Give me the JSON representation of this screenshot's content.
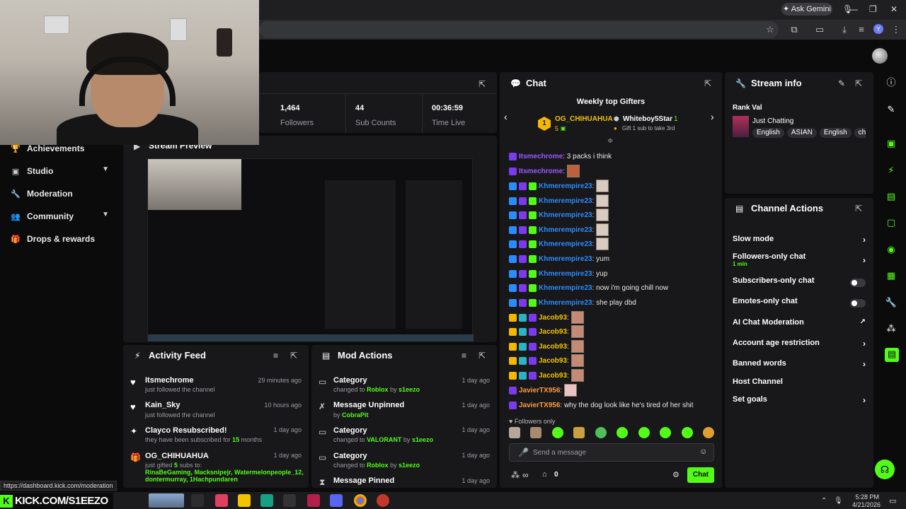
{
  "browser": {
    "gemini_label": "Ask Gemini"
  },
  "sidebar": {
    "items": [
      {
        "label": "Achievements",
        "icon": "trophy-icon"
      },
      {
        "label": "Studio",
        "icon": "studio-icon"
      },
      {
        "label": "Moderation",
        "icon": "wrench-icon"
      },
      {
        "label": "Community",
        "icon": "people-icon"
      },
      {
        "label": "Drops & rewards",
        "icon": "gift-icon"
      }
    ]
  },
  "stats": {
    "followers_value": "1,464",
    "followers_label": "Followers",
    "subs_value": "44",
    "subs_label": "Sub Counts",
    "time_value": "00:36:59",
    "time_label": "Time Live"
  },
  "stream_preview": {
    "title": "Stream Preview"
  },
  "activity": {
    "title": "Activity Feed",
    "items": [
      {
        "name": "Itsmechrome",
        "sub": "just followed the channel",
        "time": "29 minutes ago"
      },
      {
        "name": "Kain_Sky",
        "sub": "just followed the channel",
        "time": "10 hours ago"
      },
      {
        "name": "Clayco Resubscribed!",
        "sub": "they have been subscribed for",
        "months": "15",
        "months_label": "months",
        "time": "1 day ago"
      },
      {
        "name": "OG_CHIHUAHUA",
        "sub": "just gifted",
        "gift_count": "5",
        "gift_label": "subs to:",
        "recipients_1": "RinaBeGaming, Macksnipejr, Watermelonpeople_12,",
        "recipients_2": "dontermurray, 1Hachpundaren",
        "time": "1 day ago"
      }
    ]
  },
  "mod_actions": {
    "title": "Mod Actions",
    "items": [
      {
        "title": "Category",
        "sub_pre": "changed to",
        "sub_val": "Roblox",
        "by": "by",
        "user": "s1eezo",
        "time": "1 day ago"
      },
      {
        "title": "Message Unpinned",
        "sub_pre": "by",
        "sub_val": "",
        "by": "",
        "user": "CobraPit",
        "time": "1 day ago"
      },
      {
        "title": "Category",
        "sub_pre": "changed to",
        "sub_val": "VALORANT",
        "by": "by",
        "user": "s1eezo",
        "time": "1 day ago"
      },
      {
        "title": "Category",
        "sub_pre": "changed to",
        "sub_val": "Roblox",
        "by": "by",
        "user": "s1eezo",
        "time": "1 day ago"
      },
      {
        "title": "Message Pinned",
        "sub_pre": "",
        "sub_val": "",
        "by": "",
        "user": "",
        "time": "1 day ago"
      }
    ]
  },
  "chat": {
    "title": "Chat",
    "gifters_title": "Weekly top Gifters",
    "gifter1_name": "OG_CHIHUAHUA",
    "gifter1_count": "5",
    "gifter1_rank": "1",
    "gifter2_name": "Whiteboy5Star",
    "gifter2_count": "1",
    "gifter2_note": "Gift 1 sub to take 3rd",
    "messages": [
      {
        "user": "Itsmechrome",
        "text": ": 3 packs i think",
        "color": "#9b59ff"
      },
      {
        "user": "Itsmechrome",
        "text": ":",
        "color": "#9b59ff"
      },
      {
        "user": "Khmerempire23",
        "text": ":",
        "color": "#2b8cff"
      },
      {
        "user": "Khmerempire23",
        "text": ":",
        "color": "#2b8cff"
      },
      {
        "user": "Khmerempire23",
        "text": ":",
        "color": "#2b8cff"
      },
      {
        "user": "Khmerempire23",
        "text": ":",
        "color": "#2b8cff"
      },
      {
        "user": "Khmerempire23",
        "text": ":",
        "color": "#2b8cff"
      },
      {
        "user": "Khmerempire23",
        "text": ": yum",
        "color": "#2b8cff"
      },
      {
        "user": "Khmerempire23",
        "text": ": yup",
        "color": "#2b8cff"
      },
      {
        "user": "Khmerempire23",
        "text": ": now i'm going chill now",
        "color": "#2b8cff"
      },
      {
        "user": "Khmerempire23",
        "text": ": she play dbd",
        "color": "#2b8cff"
      },
      {
        "user": "Jacob93",
        "text": ":",
        "color": "#f5c400"
      },
      {
        "user": "Jacob93",
        "text": ":",
        "color": "#f5c400"
      },
      {
        "user": "Jacob93",
        "text": ":",
        "color": "#f5c400"
      },
      {
        "user": "Jacob93",
        "text": ":",
        "color": "#f5c400"
      },
      {
        "user": "Jacob93",
        "text": ":",
        "color": "#f5c400"
      },
      {
        "user": "JavierTX956",
        "text": ":",
        "color": "#ff9a3c"
      },
      {
        "user": "JavierTX956",
        "text": ": why the dog look like he's tired of her shit",
        "color": "#ff9a3c"
      }
    ],
    "followers_only": "Followers only",
    "input_placeholder": "Send a message",
    "viewer_count": "0",
    "send_label": "Chat"
  },
  "stream_info": {
    "title": "Stream info",
    "stream_title": "Rank Val",
    "category": "Just Chatting",
    "tags": [
      "English",
      "ASIAN",
      "English",
      "chil"
    ]
  },
  "channel_actions": {
    "title": "Channel Actions",
    "rows": [
      {
        "label": "Slow mode",
        "sub": "",
        "kind": "chevron"
      },
      {
        "label": "Followers-only chat",
        "sub": "1 min",
        "kind": "chevron"
      },
      {
        "label": "Subscribers-only chat",
        "sub": "",
        "kind": "toggle"
      },
      {
        "label": "Emotes-only chat",
        "sub": "",
        "kind": "toggle"
      },
      {
        "label": "AI Chat Moderation",
        "sub": "",
        "kind": "external"
      },
      {
        "label": "Account age restriction",
        "sub": "",
        "kind": "chevron"
      },
      {
        "label": "Banned words",
        "sub": "",
        "kind": "chevron"
      },
      {
        "label": "Host Channel",
        "sub": "",
        "kind": "none"
      },
      {
        "label": "Set goals",
        "sub": "",
        "kind": "chevron"
      }
    ]
  },
  "status_url": "https://dashboard.kick.com/moderation",
  "overlay_brand": "KICK.COM/S1EEZO",
  "taskbar": {
    "time": "5:28 PM",
    "date": "4/21/2026"
  },
  "colors": {
    "accent": "#53fc18",
    "panel": "#18181b",
    "background": "#0b0b0c"
  }
}
